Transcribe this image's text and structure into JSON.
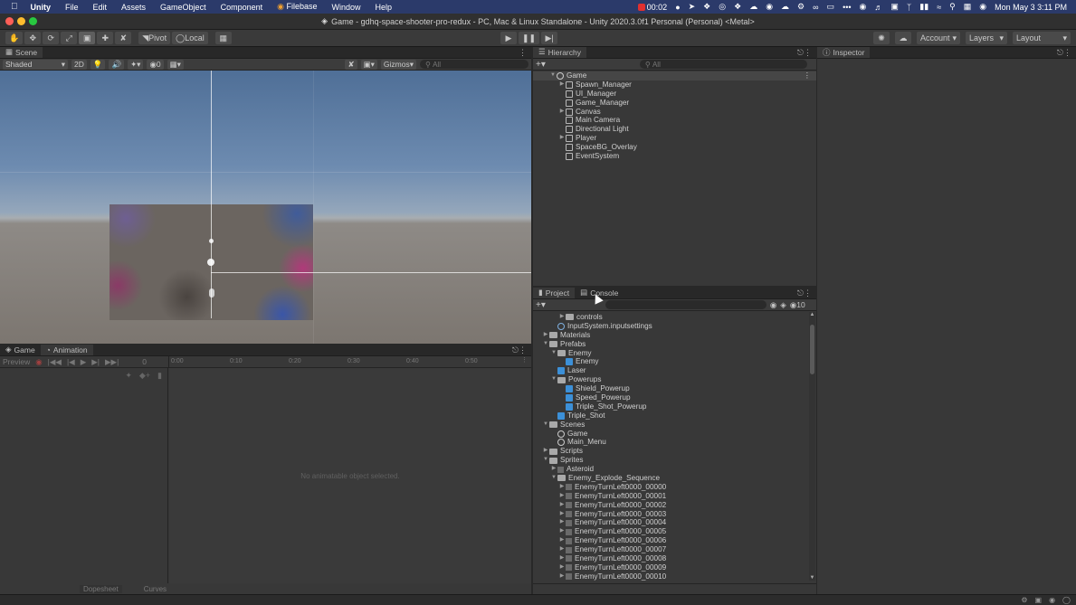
{
  "menubar": {
    "app_name": "Unity",
    "items": [
      "File",
      "Edit",
      "Assets",
      "GameObject",
      "Component",
      "Filebase",
      "Window",
      "Help"
    ],
    "recording_time": "00:02",
    "clock": "Mon May 3  3:11 PM"
  },
  "window": {
    "title": "Game - gdhq-space-shooter-pro-redux - PC, Mac & Linux Standalone - Unity 2020.3.0f1 Personal (Personal) <Metal>"
  },
  "toolbar": {
    "pivot": "Pivot",
    "local": "Local",
    "account": "Account",
    "layers": "Layers",
    "layout": "Layout"
  },
  "scene": {
    "tab": "Scene",
    "shading": "Shaded",
    "mode_2d": "2D",
    "hidden_count": "0",
    "gizmos": "Gizmos",
    "search_placeholder": "All"
  },
  "hierarchy": {
    "tab": "Hierarchy",
    "search_placeholder": "All",
    "root": "Game",
    "items": [
      {
        "label": "Spawn_Manager",
        "expandable": true
      },
      {
        "label": "UI_Manager",
        "expandable": false
      },
      {
        "label": "Game_Manager",
        "expandable": false
      },
      {
        "label": "Canvas",
        "expandable": true
      },
      {
        "label": "Main Camera",
        "expandable": false
      },
      {
        "label": "Directional Light",
        "expandable": false
      },
      {
        "label": "Player",
        "expandable": true
      },
      {
        "label": "SpaceBG_Overlay",
        "expandable": false
      },
      {
        "label": "EventSystem",
        "expandable": false
      }
    ]
  },
  "inspector": {
    "tab": "Inspector"
  },
  "animation": {
    "tabs": [
      "Game",
      "Animation"
    ],
    "preview": "Preview",
    "frame": "0",
    "ruler": [
      "0:00",
      "0:10",
      "0:20",
      "0:30",
      "0:40",
      "0:50"
    ],
    "empty_message": "No animatable object selected.",
    "bottom_tabs": [
      "Dopesheet",
      "Curves"
    ]
  },
  "project": {
    "tabs": [
      "Project",
      "Console"
    ],
    "hidden_count": "10",
    "rows": [
      {
        "label": "controls",
        "icon": "folder",
        "indent": 2,
        "arrow": "right"
      },
      {
        "label": "InputSystem.inputsettings",
        "icon": "asset",
        "indent": 1,
        "arrow": ""
      },
      {
        "label": "Materials",
        "icon": "folder",
        "indent": 0,
        "arrow": "right"
      },
      {
        "label": "Prefabs",
        "icon": "folder",
        "indent": 0,
        "arrow": "down"
      },
      {
        "label": "Enemy",
        "icon": "folder",
        "indent": 1,
        "arrow": "down"
      },
      {
        "label": "Enemy",
        "icon": "prefab",
        "indent": 2,
        "arrow": ""
      },
      {
        "label": "Laser",
        "icon": "prefab",
        "indent": 1,
        "arrow": ""
      },
      {
        "label": "Powerups",
        "icon": "folder",
        "indent": 1,
        "arrow": "down"
      },
      {
        "label": "Shield_Powerup",
        "icon": "prefab",
        "indent": 2,
        "arrow": ""
      },
      {
        "label": "Speed_Powerup",
        "icon": "prefab",
        "indent": 2,
        "arrow": ""
      },
      {
        "label": "Triple_Shot_Powerup",
        "icon": "prefab",
        "indent": 2,
        "arrow": ""
      },
      {
        "label": "Triple_Shot",
        "icon": "prefab",
        "indent": 1,
        "arrow": ""
      },
      {
        "label": "Scenes",
        "icon": "folder",
        "indent": 0,
        "arrow": "down"
      },
      {
        "label": "Game",
        "icon": "scene",
        "indent": 1,
        "arrow": ""
      },
      {
        "label": "Main_Menu",
        "icon": "scene",
        "indent": 1,
        "arrow": ""
      },
      {
        "label": "Scripts",
        "icon": "folder",
        "indent": 0,
        "arrow": "right"
      },
      {
        "label": "Sprites",
        "icon": "folder",
        "indent": 0,
        "arrow": "down"
      },
      {
        "label": "Asteroid",
        "icon": "sprite",
        "indent": 1,
        "arrow": "right"
      },
      {
        "label": "Enemy_Explode_Sequence",
        "icon": "folder",
        "indent": 1,
        "arrow": "down"
      },
      {
        "label": "EnemyTurnLeft0000_00000",
        "icon": "sprite",
        "indent": 2,
        "arrow": "right"
      },
      {
        "label": "EnemyTurnLeft0000_00001",
        "icon": "sprite",
        "indent": 2,
        "arrow": "right"
      },
      {
        "label": "EnemyTurnLeft0000_00002",
        "icon": "sprite",
        "indent": 2,
        "arrow": "right"
      },
      {
        "label": "EnemyTurnLeft0000_00003",
        "icon": "sprite",
        "indent": 2,
        "arrow": "right"
      },
      {
        "label": "EnemyTurnLeft0000_00004",
        "icon": "sprite",
        "indent": 2,
        "arrow": "right"
      },
      {
        "label": "EnemyTurnLeft0000_00005",
        "icon": "sprite",
        "indent": 2,
        "arrow": "right"
      },
      {
        "label": "EnemyTurnLeft0000_00006",
        "icon": "sprite",
        "indent": 2,
        "arrow": "right"
      },
      {
        "label": "EnemyTurnLeft0000_00007",
        "icon": "sprite",
        "indent": 2,
        "arrow": "right"
      },
      {
        "label": "EnemyTurnLeft0000_00008",
        "icon": "sprite",
        "indent": 2,
        "arrow": "right"
      },
      {
        "label": "EnemyTurnLeft0000_00009",
        "icon": "sprite",
        "indent": 2,
        "arrow": "right"
      },
      {
        "label": "EnemyTurnLeft0000_00010",
        "icon": "sprite",
        "indent": 2,
        "arrow": "right"
      }
    ]
  }
}
